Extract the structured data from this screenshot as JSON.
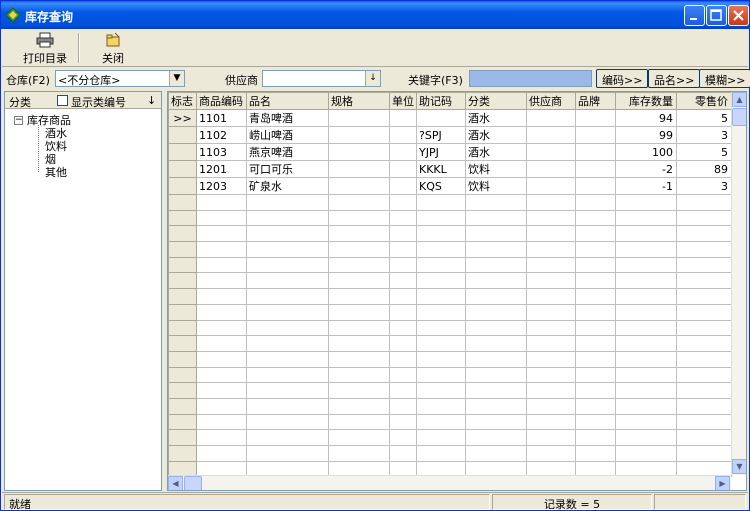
{
  "window": {
    "title": "库存查询",
    "icons": {
      "app": "app-diamond-icon",
      "minimize": "minimize-icon",
      "maximize": "maximize-icon",
      "close": "close-icon"
    }
  },
  "toolbar": {
    "print_label": "打印目录",
    "close_label": "关闭"
  },
  "filters": {
    "warehouse_label": "仓库(F2)",
    "warehouse_value": "<不分仓库>",
    "supplier_label": "供应商",
    "supplier_value": "",
    "keyword_label": "关键字(F3)",
    "keyword_value": "",
    "code_button": "编码>>",
    "name_button": "品名>>",
    "fuzzy_button": "模糊>>"
  },
  "category_panel": {
    "header_label": "分类",
    "show_code_label": "显示类编号",
    "show_code_checked": false,
    "root": "库存商品",
    "children": [
      "酒水",
      "饮料",
      "烟",
      "其他"
    ]
  },
  "grid": {
    "columns": [
      "标志",
      "商品编码",
      "品名",
      "规格",
      "单位",
      "助记码",
      "分类",
      "供应商",
      "品牌",
      "库存数量",
      "零售价"
    ],
    "current_row_marker": ">>",
    "rows": [
      [
        "1101",
        "青岛啤酒",
        "",
        "",
        "",
        "酒水",
        "",
        "",
        "94",
        "5"
      ],
      [
        "1102",
        "崂山啤酒",
        "",
        "",
        "?SPJ",
        "酒水",
        "",
        "",
        "99",
        "3"
      ],
      [
        "1103",
        "燕京啤酒",
        "",
        "",
        "YJPJ",
        "酒水",
        "",
        "",
        "100",
        "5"
      ],
      [
        "1201",
        "可口可乐",
        "",
        "",
        "KKKL",
        "饮料",
        "",
        "",
        "-2",
        "89"
      ],
      [
        "1203",
        "矿泉水",
        "",
        "",
        "KQS",
        "饮料",
        "",
        "",
        "-1",
        "3"
      ]
    ],
    "empty_row_count": 18
  },
  "status": {
    "state": "就绪",
    "record_count": "记录数 = 5"
  },
  "colors": {
    "titlebar": "#0058e6",
    "face": "#ece9d8",
    "keyword_field": "#9ab8e8"
  }
}
